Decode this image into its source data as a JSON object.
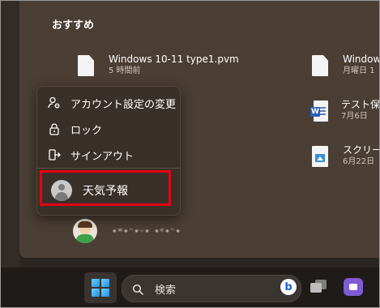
{
  "start_menu": {
    "section_title": "おすすめ",
    "recommended": [
      {
        "name": "Windows 10-11 type1.pvm",
        "date": "5 時間前",
        "icon": "file-icon"
      },
      {
        "name": "Windows",
        "date": "月曜日 1",
        "icon": "file-icon"
      },
      {
        "name": "テスト保存",
        "date": "7月6日",
        "icon": "word-doc-icon"
      },
      {
        "name": "スクリーン",
        "date": "6月22日",
        "icon": "image-file-icon"
      }
    ],
    "account_menu": {
      "items": [
        {
          "label": "アカウント設定の変更",
          "icon": "account-settings-icon"
        },
        {
          "label": "ロック",
          "icon": "lock-icon"
        },
        {
          "label": "サインアウト",
          "icon": "sign-out-icon"
        }
      ],
      "other_user": {
        "label": "天気予報",
        "icon": "default-avatar-icon"
      }
    },
    "current_user": {
      "name": "•ʷ•ᵔ•ᵕ• •ᵉ•ᵔ•"
    }
  },
  "taskbar": {
    "search_label": "検索",
    "bing_label": "b"
  },
  "colors": {
    "highlight": "#e60012",
    "accent": "#1c8fe0"
  }
}
